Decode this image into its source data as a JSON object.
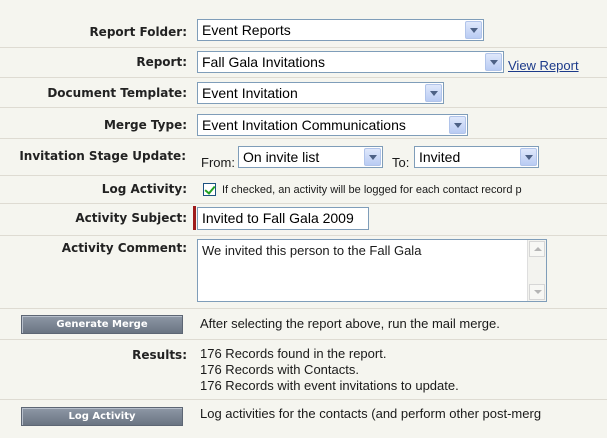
{
  "form": {
    "report_folder": {
      "label": "Report Folder:",
      "value": "Event Reports"
    },
    "report": {
      "label": "Report:",
      "value": "Fall Gala Invitations",
      "view_link": "View Report"
    },
    "document_template": {
      "label": "Document Template:",
      "value": "Event Invitation"
    },
    "merge_type": {
      "label": "Merge Type:",
      "value": "Event Invitation Communications"
    },
    "stage_update": {
      "label": "Invitation Stage Update:",
      "from_label": "From:",
      "from_value": "On invite list",
      "to_label": "To:",
      "to_value": "Invited"
    },
    "log_activity": {
      "label": "Log Activity:",
      "checked": true,
      "note": "If checked, an activity will be logged for each contact record p"
    },
    "activity_subject": {
      "label": "Activity Subject:",
      "value": "Invited to Fall Gala 2009"
    },
    "activity_comment": {
      "label": "Activity Comment:",
      "value": "We invited this person to the Fall Gala"
    },
    "generate": {
      "button": "Generate Merge",
      "help": "After selecting the report above, run the mail merge."
    },
    "results": {
      "label": "Results:",
      "lines": [
        "176 Records found in the report.",
        "176 Records with Contacts.",
        "176 Records with event invitations to update."
      ]
    },
    "log": {
      "button": "Log Activity",
      "help": "Log activities for the contacts (and perform other post-merg"
    }
  },
  "colors": {
    "panel_bg": "#f5f5ef",
    "required_marker": "#9e1b1b",
    "field_border": "#7f9db9",
    "link": "#1c3a8a"
  }
}
